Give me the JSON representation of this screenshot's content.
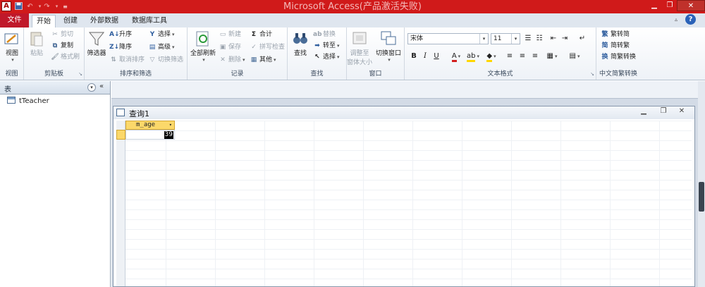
{
  "window": {
    "title": "Microsoft Access(产品激活失败)",
    "app_icon": "A",
    "colors": {
      "titlebar": "#d01a1a",
      "file_tab": "#c0182a",
      "accent_header": "#fbd86a"
    }
  },
  "quick_access": [
    "save-icon",
    "undo-icon",
    "redo-icon",
    "customize-icon"
  ],
  "tabs": [
    {
      "label": "文件"
    },
    {
      "label": "开始"
    },
    {
      "label": "创建"
    },
    {
      "label": "外部数据"
    },
    {
      "label": "数据库工具"
    }
  ],
  "ribbon": {
    "view": {
      "label": "视图",
      "group": "视图"
    },
    "clipboard": {
      "paste": "粘贴",
      "cut": "剪切",
      "copy": "复制",
      "format_painter": "格式刷",
      "group": "剪贴板"
    },
    "sort_filter": {
      "filter": "筛选器",
      "asc": "升序",
      "desc": "降序",
      "clear_sort": "取消排序",
      "selection": "选择",
      "advanced": "高级",
      "toggle_filter": "切换筛选",
      "group": "排序和筛选"
    },
    "records": {
      "refresh_all": "全部刷新",
      "new": "新建",
      "save": "保存",
      "delete": "删除",
      "totals": "合计",
      "spelling": "拼写检查",
      "more": "其他",
      "group": "记录"
    },
    "find": {
      "find": "查找",
      "replace": "替换",
      "goto": "转至",
      "select": "选择",
      "group": "查找"
    },
    "window": {
      "size_to_fit": "调整至",
      "size_to_fit2": "窗体大小",
      "switch_windows": "切换窗口",
      "group": "窗口"
    },
    "text_format": {
      "font": "宋体",
      "size": "11",
      "bold": "B",
      "italic": "I",
      "underline": "U",
      "group": "文本格式"
    },
    "chinese": {
      "trad": "繁转简",
      "simp": "简转繁",
      "conv": "简繁转换",
      "group": "中文简繁转换"
    }
  },
  "nav_pane": {
    "header": "表",
    "items": [
      {
        "label": "tTeacher"
      }
    ]
  },
  "query": {
    "title": "查询1",
    "column": "m_age",
    "value": "39"
  }
}
